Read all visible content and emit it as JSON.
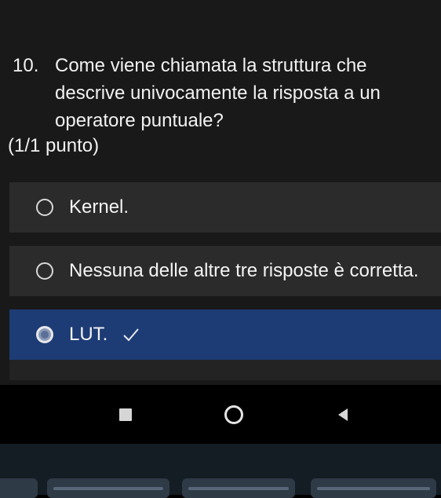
{
  "question": {
    "number": "10.",
    "line1": "Come viene chiamata la struttura che",
    "line2": "descrive univocamente la risposta a un",
    "line3": "operatore puntuale?",
    "points": "(1/1 punto)"
  },
  "options": [
    {
      "label": "Kernel.",
      "selected": false
    },
    {
      "label": "Nessuna delle altre tre risposte è corretta.",
      "selected": false
    },
    {
      "label": "LUT.",
      "selected": true,
      "correct": true
    }
  ],
  "colors": {
    "background": "#191919",
    "option_bg": "#2b2b2b",
    "selected_bg": "#1d3c76",
    "text": "#f2f2f2"
  },
  "navbar": {
    "icons": [
      "recents-square-icon",
      "home-circle-icon",
      "back-triangle-icon"
    ]
  }
}
